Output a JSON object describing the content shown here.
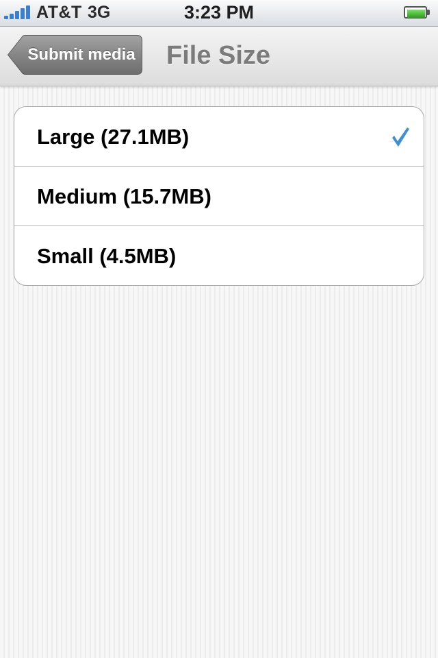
{
  "status_bar": {
    "carrier": "AT&T",
    "network": "3G",
    "time": "3:23 PM",
    "signal_icon": "signal-bars-icon",
    "battery_icon": "battery-icon",
    "signal_color": "#3a7fd0",
    "battery_color": "#2d9b1c"
  },
  "nav_bar": {
    "back_label": "Submit media",
    "title": "File Size"
  },
  "options": [
    {
      "label": "Large (27.1MB)",
      "selected": true
    },
    {
      "label": "Medium (15.7MB)",
      "selected": false
    },
    {
      "label": "Small (4.5MB)",
      "selected": false
    }
  ],
  "checkmark_icon": "checkmark-icon",
  "checkmark_color": "#3d8fd6"
}
